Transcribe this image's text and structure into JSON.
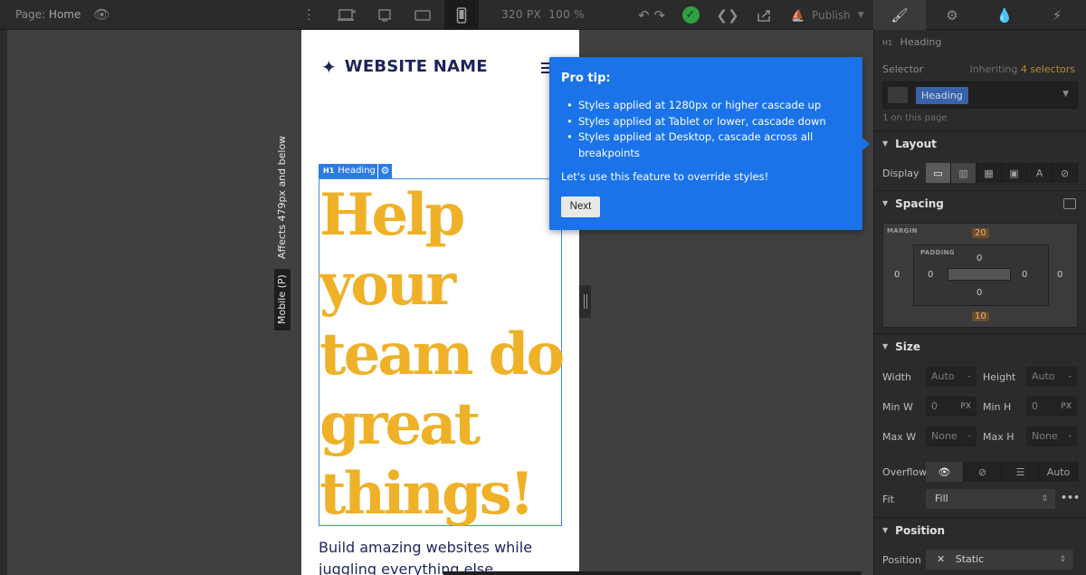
{
  "topbar": {
    "page_label": "Page:",
    "page_name": "Home",
    "canvas_width": "320",
    "canvas_width_unit": "PX",
    "zoom": "100",
    "zoom_unit": "%",
    "publish_label": "Publish"
  },
  "breakpoint": {
    "affects": "Affects 479px and below",
    "name": "Mobile (P)"
  },
  "site": {
    "logo_icon": "sparkle-icon",
    "website_name": "WEBSITE NAME",
    "selected_tag": "Heading",
    "selected_tag_type": "H1",
    "headline": "Help your team do great things!",
    "subtext": "Build amazing websites while juggling everything else"
  },
  "tip": {
    "title": "Pro tip:",
    "items": [
      "Styles applied at 1280px or higher cascade up",
      "Styles applied at Tablet or lower, cascade down",
      "Styles applied at Desktop, cascade across all breakpoints"
    ],
    "body": "Let's use this feature to override styles!",
    "next_label": "Next"
  },
  "panel": {
    "element_type": "H1",
    "element_name": "Heading",
    "selector_label": "Selector",
    "inheriting_prefix": "Inheriting",
    "inheriting_count": "4 selectors",
    "selector_chip": "Heading",
    "on_page": "1 on this page",
    "layout": {
      "title": "Layout",
      "display_label": "Display"
    },
    "spacing": {
      "title": "Spacing",
      "margin_caption": "MARGIN",
      "padding_caption": "PADDING",
      "margin_top": "20",
      "margin_bottom": "10",
      "margin_left": "0",
      "margin_right": "0",
      "padding_top": "0",
      "padding_bottom": "0",
      "padding_left": "0",
      "padding_right": "0"
    },
    "size": {
      "title": "Size",
      "width_label": "Width",
      "width_value": "Auto",
      "height_label": "Height",
      "height_value": "Auto",
      "minw_label": "Min W",
      "minw_value": "0",
      "minh_label": "Min H",
      "minh_value": "0",
      "maxw_label": "Max W",
      "maxw_value": "None",
      "maxh_label": "Max H",
      "maxh_value": "None",
      "unit_px": "PX",
      "unit_dash": "-",
      "overflow_label": "Overflow",
      "overflow_auto": "Auto",
      "fit_label": "Fit",
      "fit_value": "Fill"
    },
    "position": {
      "title": "Position",
      "position_label": "Position",
      "position_value": "Static"
    }
  },
  "colors": {
    "accent_blue": "#1a73e8",
    "headline_gold": "#efb128",
    "brand_navy": "#1c2558",
    "success_green": "#2ea043"
  }
}
